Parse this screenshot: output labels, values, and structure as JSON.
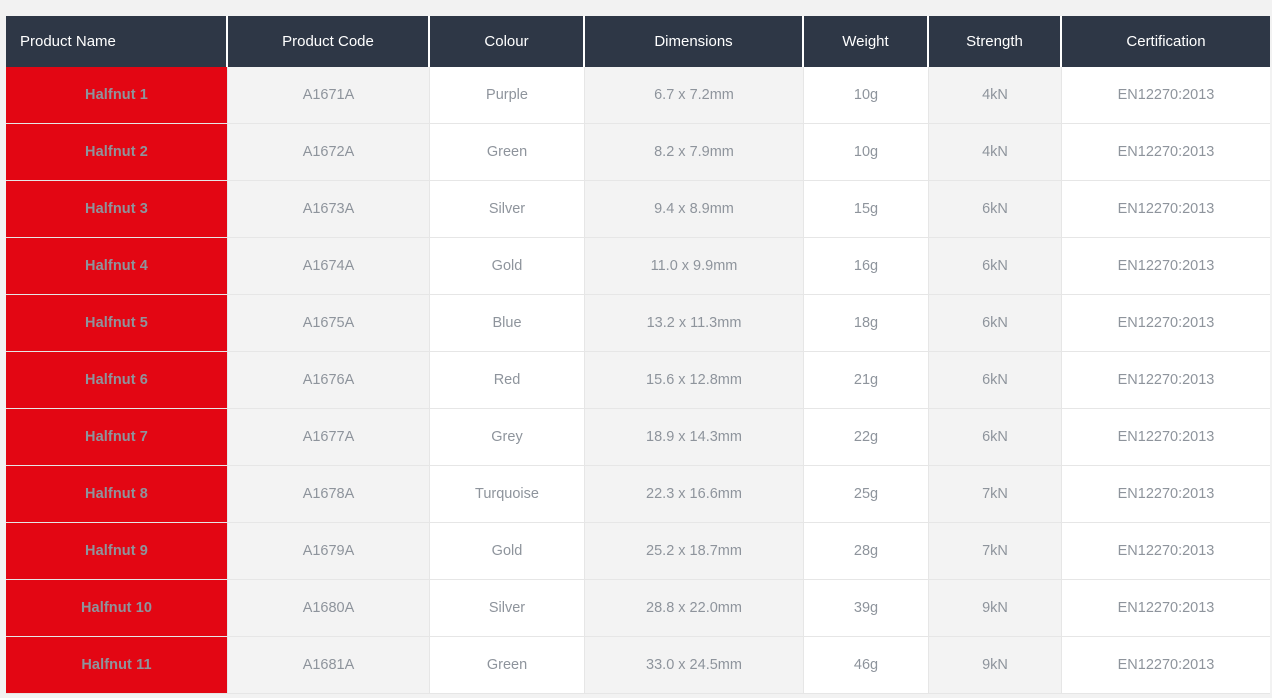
{
  "table": {
    "columns": [
      {
        "key": "product_name",
        "label": "Product Name",
        "align": "left"
      },
      {
        "key": "product_code",
        "label": "Product Code",
        "align": "center"
      },
      {
        "key": "colour",
        "label": "Colour",
        "align": "center"
      },
      {
        "key": "dimensions",
        "label": "Dimensions",
        "align": "center"
      },
      {
        "key": "weight",
        "label": "Weight",
        "align": "center"
      },
      {
        "key": "strength",
        "label": "Strength",
        "align": "center"
      },
      {
        "key": "certification",
        "label": "Certification",
        "align": "center"
      }
    ],
    "colors": {
      "header_background": "#2e3746",
      "header_text": "#ffffff",
      "name_cell_background": "#e30613",
      "name_cell_text": "#ffffff",
      "cell_text": "#8e949c",
      "shaded_column_background": "#f3f3f3",
      "plain_column_background": "#ffffff",
      "page_background": "#f2f2f2",
      "cell_border": "#e6e6e6"
    },
    "rows": [
      {
        "product_name": "Halfnut 1",
        "product_code": "A1671A",
        "colour": "Purple",
        "dimensions": "6.7 x 7.2mm",
        "weight": "10g",
        "strength": "4kN",
        "certification": "EN12270:2013"
      },
      {
        "product_name": "Halfnut 2",
        "product_code": "A1672A",
        "colour": "Green",
        "dimensions": "8.2 x 7.9mm",
        "weight": "10g",
        "strength": "4kN",
        "certification": "EN12270:2013"
      },
      {
        "product_name": "Halfnut 3",
        "product_code": "A1673A",
        "colour": "Silver",
        "dimensions": "9.4 x 8.9mm",
        "weight": "15g",
        "strength": "6kN",
        "certification": "EN12270:2013"
      },
      {
        "product_name": "Halfnut 4",
        "product_code": "A1674A",
        "colour": "Gold",
        "dimensions": "11.0 x 9.9mm",
        "weight": "16g",
        "strength": "6kN",
        "certification": "EN12270:2013"
      },
      {
        "product_name": "Halfnut 5",
        "product_code": "A1675A",
        "colour": "Blue",
        "dimensions": "13.2 x 11.3mm",
        "weight": "18g",
        "strength": "6kN",
        "certification": "EN12270:2013"
      },
      {
        "product_name": "Halfnut 6",
        "product_code": "A1676A",
        "colour": "Red",
        "dimensions": "15.6 x 12.8mm",
        "weight": "21g",
        "strength": "6kN",
        "certification": "EN12270:2013"
      },
      {
        "product_name": "Halfnut 7",
        "product_code": "A1677A",
        "colour": "Grey",
        "dimensions": "18.9 x 14.3mm",
        "weight": "22g",
        "strength": "6kN",
        "certification": "EN12270:2013"
      },
      {
        "product_name": "Halfnut 8",
        "product_code": "A1678A",
        "colour": "Turquoise",
        "dimensions": "22.3 x 16.6mm",
        "weight": "25g",
        "strength": "7kN",
        "certification": "EN12270:2013"
      },
      {
        "product_name": "Halfnut 9",
        "product_code": "A1679A",
        "colour": "Gold",
        "dimensions": "25.2 x 18.7mm",
        "weight": "28g",
        "strength": "7kN",
        "certification": "EN12270:2013"
      },
      {
        "product_name": "Halfnut 10",
        "product_code": "A1680A",
        "colour": "Silver",
        "dimensions": "28.8 x 22.0mm",
        "weight": "39g",
        "strength": "9kN",
        "certification": "EN12270:2013"
      },
      {
        "product_name": "Halfnut 11",
        "product_code": "A1681A",
        "colour": "Green",
        "dimensions": "33.0 x 24.5mm",
        "weight": "46g",
        "strength": "9kN",
        "certification": "EN12270:2013"
      }
    ]
  }
}
